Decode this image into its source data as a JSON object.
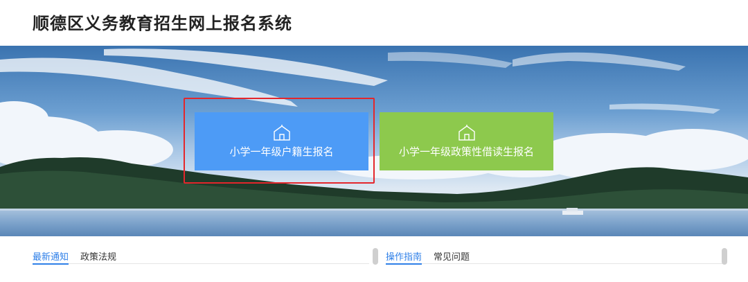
{
  "header": {
    "title": "顺德区义务教育招生网上报名系统"
  },
  "banner": {
    "buttons": [
      {
        "label": "小学一年级户籍生报名",
        "icon": "school-building-icon",
        "color": "#4d9bf6"
      },
      {
        "label": "小学一年级政策性借读生报名",
        "icon": "school-building-icon",
        "color": "#8dc94d"
      }
    ],
    "highlight_color": "#e4262b"
  },
  "left_panel": {
    "tabs": [
      {
        "label": "最新通知",
        "active": true
      },
      {
        "label": "政策法规",
        "active": false
      }
    ]
  },
  "right_panel": {
    "tabs": [
      {
        "label": "操作指南",
        "active": true
      },
      {
        "label": "常见问题",
        "active": false
      }
    ]
  },
  "colors": {
    "accent": "#2e7fe8"
  }
}
